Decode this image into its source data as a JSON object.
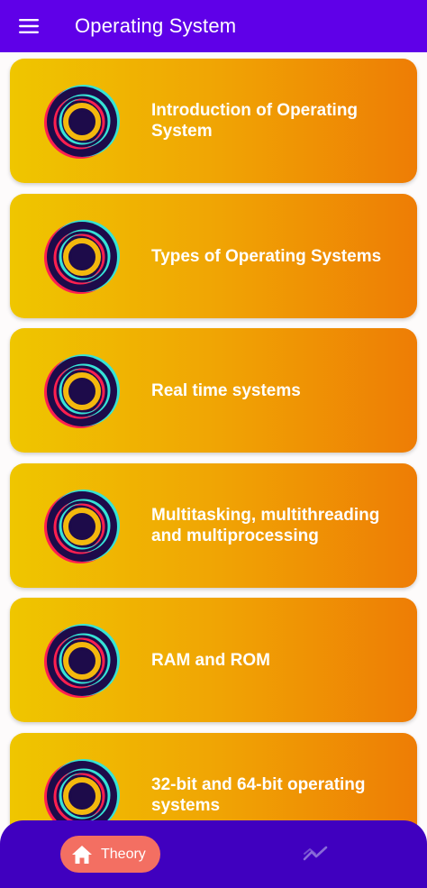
{
  "app_bar": {
    "title": "Operating System",
    "menu_icon": "hamburger-menu-icon",
    "background": "#5f00e8"
  },
  "topics": [
    {
      "label": "Introduction of Operating System",
      "icon": "ring-icon"
    },
    {
      "label": "Types of Operating Systems",
      "icon": "ring-icon"
    },
    {
      "label": "Real time systems",
      "icon": "ring-icon"
    },
    {
      "label": "Multitasking, multithreading and multiprocessing",
      "icon": "ring-icon"
    },
    {
      "label": "RAM and ROM",
      "icon": "ring-icon"
    },
    {
      "label": "32-bit and 64-bit operating systems",
      "icon": "ring-icon"
    }
  ],
  "bottom_nav": {
    "home_label": "Theory",
    "home_icon": "home-icon",
    "trend_icon": "trending-icon",
    "background": "#4000bf",
    "active_pill_color": "#f36f62"
  },
  "colors": {
    "card_gradient_start": "#efc600",
    "card_gradient_end": "#ee7d05",
    "ring_dark": "#1d0b4a",
    "ring_accent_cyan": "#36e3d6",
    "ring_accent_red": "#ff1f4f",
    "ring_gold": "#f4b80d"
  }
}
